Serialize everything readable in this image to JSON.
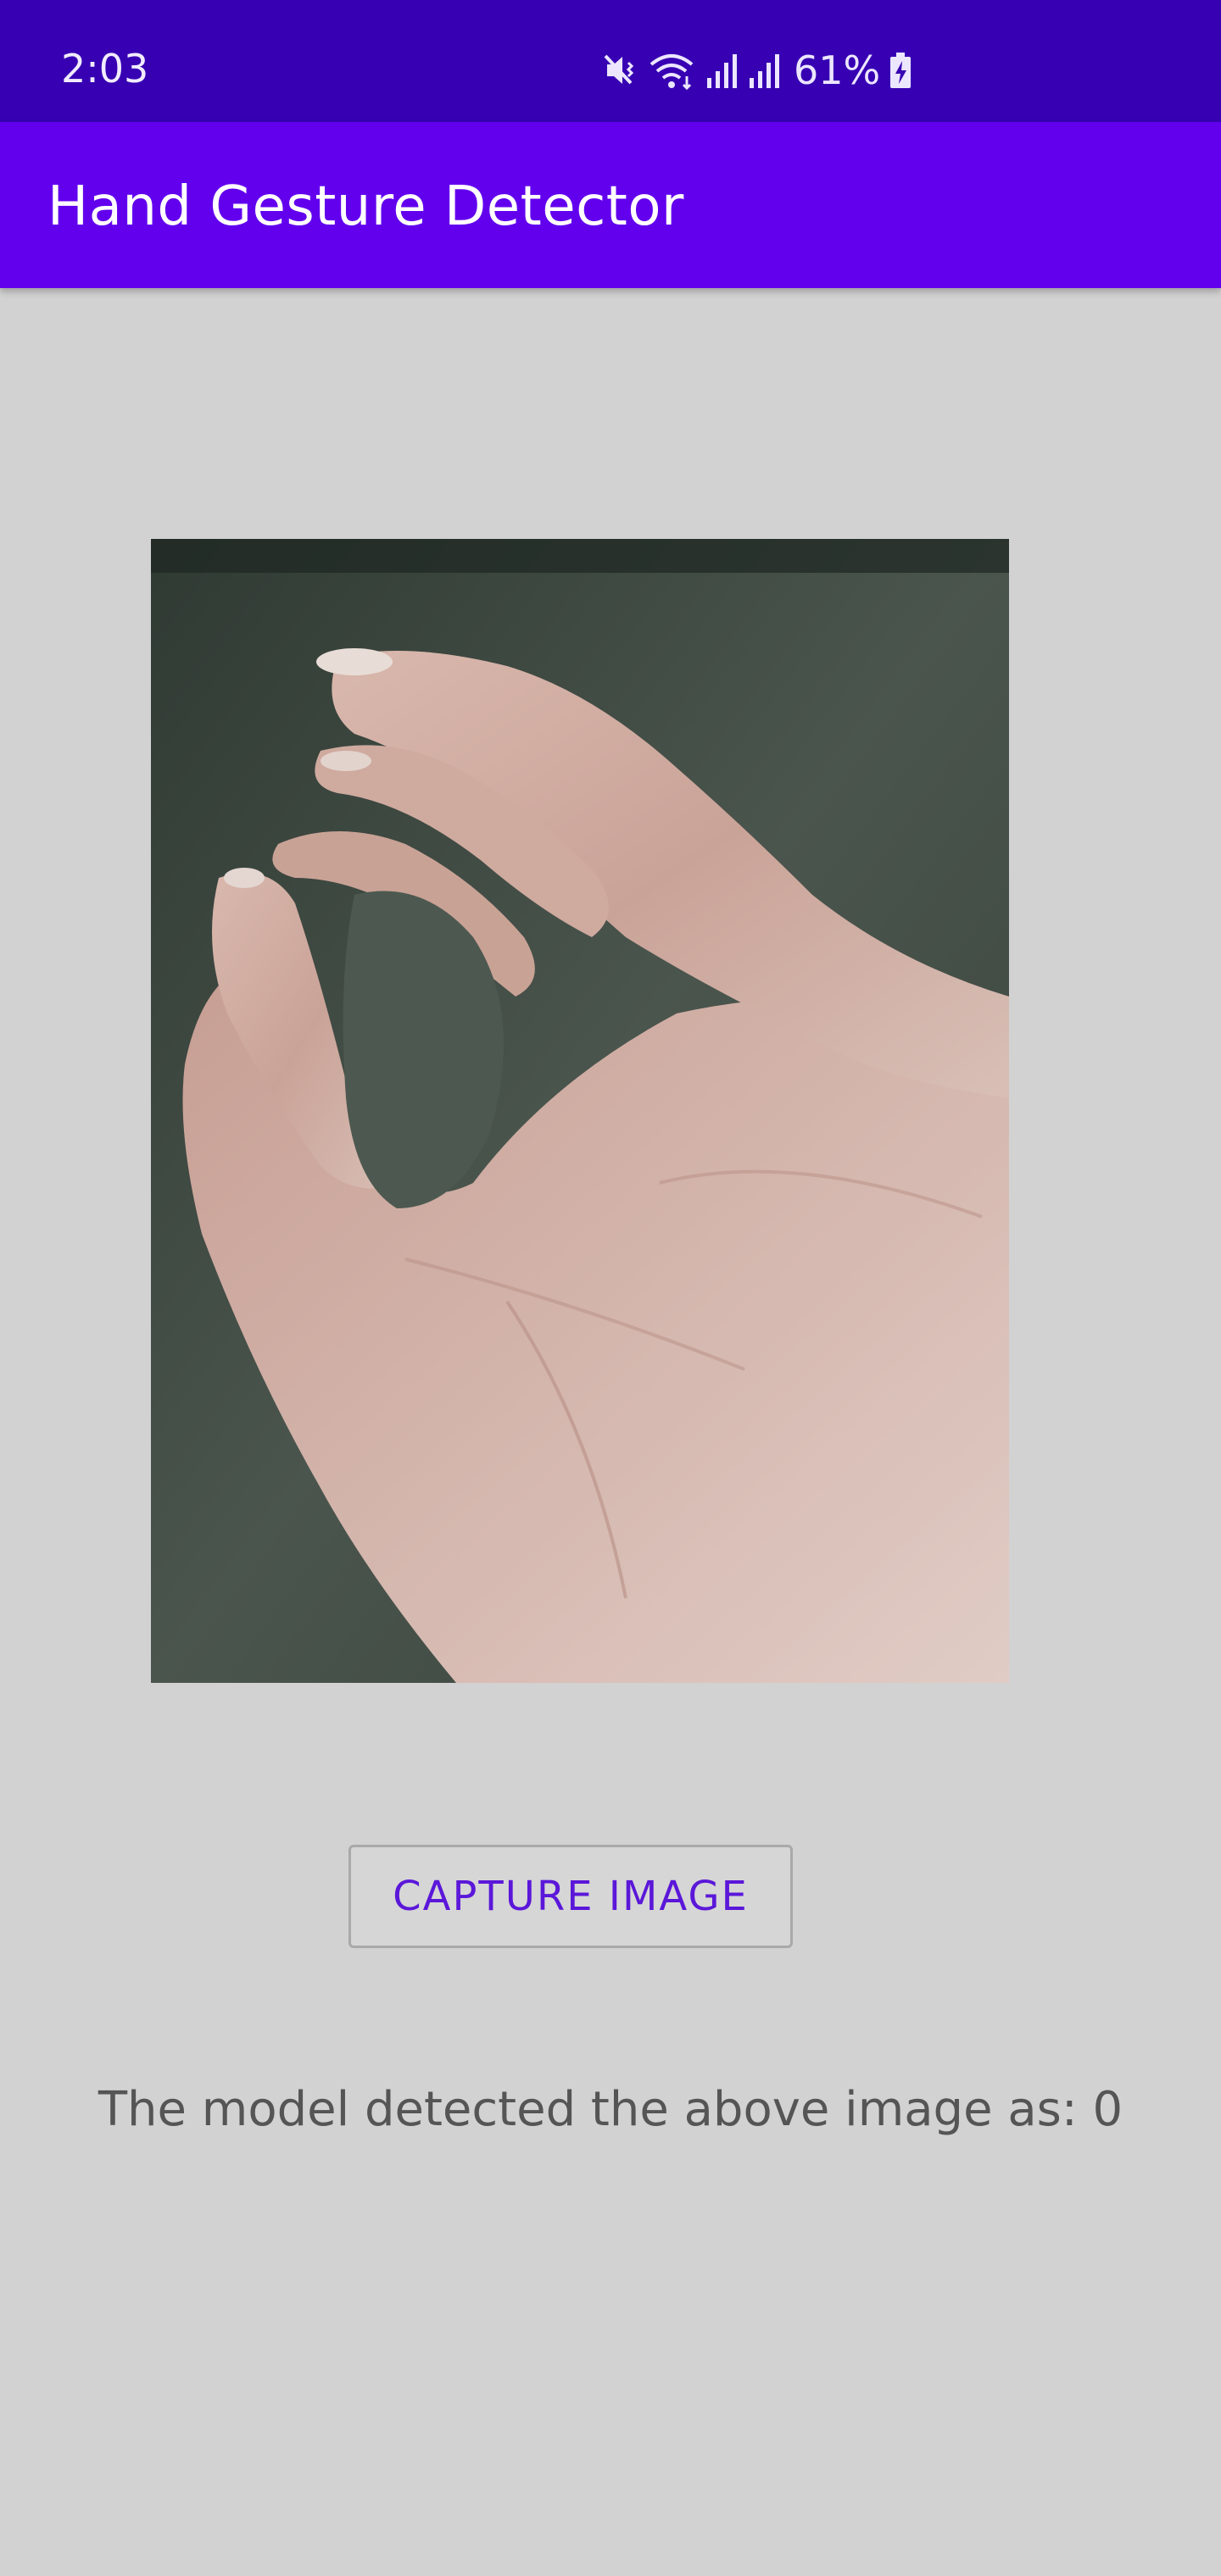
{
  "status_bar": {
    "time": "2:03",
    "battery": "61%",
    "icons": [
      "mute-vibrate-icon",
      "wifi-icon",
      "signal-icon",
      "signal-icon",
      "battery-charging-icon"
    ]
  },
  "app_bar": {
    "title": "Hand Gesture Detector"
  },
  "main": {
    "photo_icon": "hand-gesture-photo",
    "capture_button_label": "CAPTURE IMAGE",
    "result_text": "The model detected the above image as: 0"
  },
  "colors": {
    "status_bar": "#3700b3",
    "app_bar": "#6200ee",
    "background": "#d2d2d2",
    "button_text": "#5b17d9",
    "result_text": "#555555"
  }
}
